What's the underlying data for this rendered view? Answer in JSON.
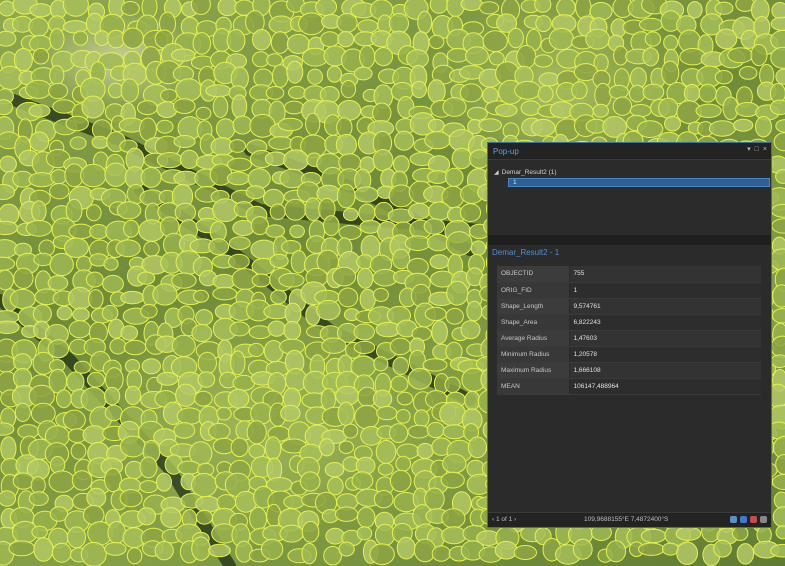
{
  "popup": {
    "title": "Pop-up",
    "controls": {
      "pin": "▾",
      "restore": "□",
      "close": "×"
    },
    "tree": {
      "layer_label": "Demar_Result2 (1)",
      "selected_feature": "1"
    },
    "section_title": "Demar_Result2 - 1",
    "attributes": [
      {
        "key": "OBJECTID",
        "value": "755"
      },
      {
        "key": "ORIG_FID",
        "value": "1"
      },
      {
        "key": "Shape_Length",
        "value": "9,574761"
      },
      {
        "key": "Shape_Area",
        "value": "6,822243"
      },
      {
        "key": "Average Radius",
        "value": "1,47603"
      },
      {
        "key": "Minimum Radius",
        "value": "1,20578"
      },
      {
        "key": "Maximum Radius",
        "value": "1,666108"
      },
      {
        "key": "MEAN",
        "value": "106147,488964"
      }
    ],
    "footer": {
      "nav": "‹ 1 of 1 ›",
      "coords": "109,9688155°E 7,4872400°S"
    }
  },
  "colors": {
    "canopy_outline": "#e6f24a",
    "accent": "#4a90d9"
  }
}
